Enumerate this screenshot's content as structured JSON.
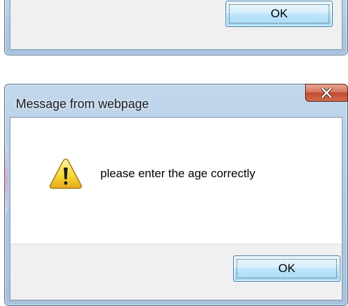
{
  "top_dialog": {
    "ok_label": "OK",
    "focused": true
  },
  "main_dialog": {
    "title": "Message from webpage",
    "close_glyph": "X",
    "icon": "warning-triangle-icon",
    "message": "please enter the age correctly",
    "ok_label": "OK",
    "focused": true
  },
  "colors": {
    "frame": "#b3cbe4",
    "close_button": "#c24c33",
    "ok_button": "#bee6fd",
    "button_strip": "#f0f0f0",
    "warning_yellow": "#f7d83a"
  }
}
